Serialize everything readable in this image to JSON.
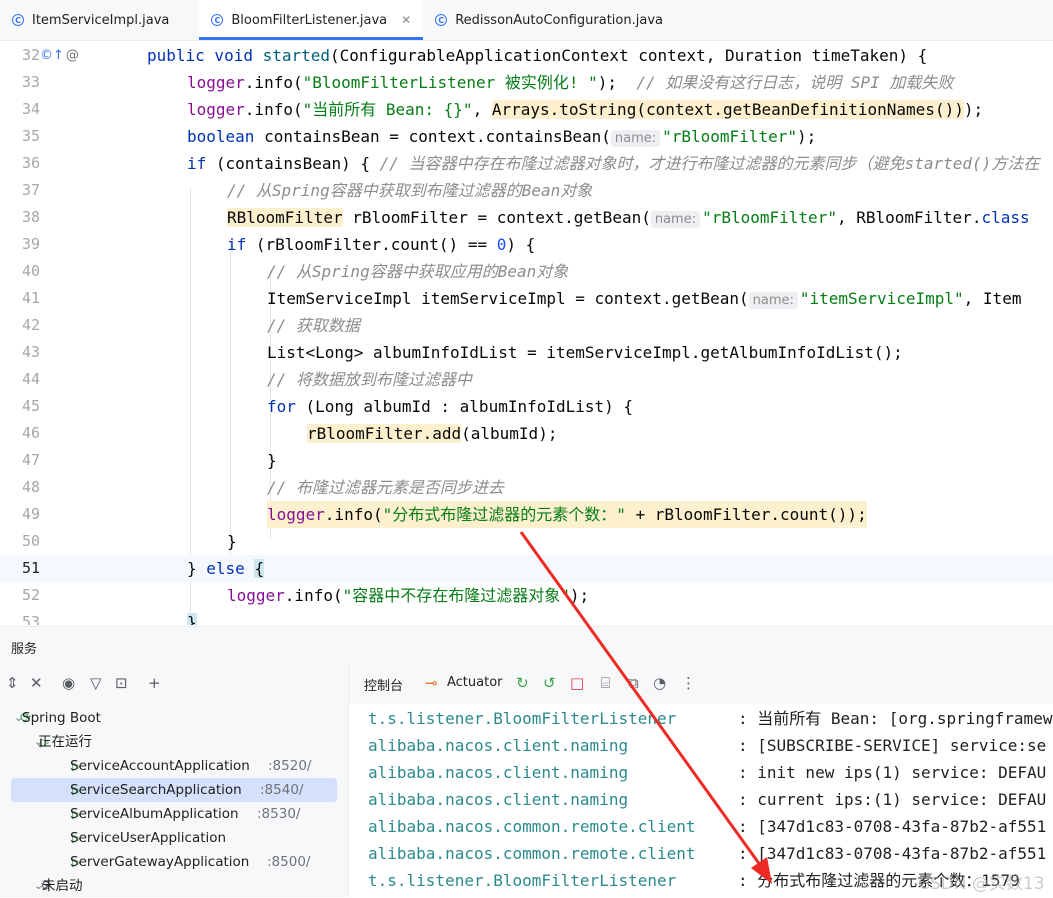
{
  "tabs": [
    {
      "label": "ItemServiceImpl.java",
      "active": false,
      "closable": false
    },
    {
      "label": "BloomFilterListener.java",
      "active": true,
      "closable": true
    },
    {
      "label": "RedissonAutoConfiguration.java",
      "active": false,
      "closable": false
    }
  ],
  "editor": {
    "line_numbers": [
      "32",
      "33",
      "34",
      "35",
      "36",
      "37",
      "38",
      "39",
      "40",
      "41",
      "42",
      "43",
      "44",
      "45",
      "46",
      "47",
      "48",
      "49",
      "50",
      "51",
      "52",
      "53"
    ],
    "current_line": "51",
    "hint_name": "name:",
    "l32": {
      "kw1": "public void ",
      "m": "started",
      "rest": "(ConfigurableApplicationContext context, Duration timeTaken) {"
    },
    "l33": {
      "f": "logger",
      "a": ".info(",
      "s": "\"BloomFilterListener 被实例化! \"",
      "b": ");  ",
      "c": "// 如果没有这行日志，说明 SPI 加载失败"
    },
    "l34": {
      "f": "logger",
      "a": ".info(",
      "s": "\"当前所有 Bean: {}\"",
      "b": ", ",
      "hl": "Arrays.toString(context.getBeanDefinitionNames())",
      "e": ");"
    },
    "l35": {
      "kw": "boolean",
      "a": " containsBean = context.containsBean(",
      "s": "\"rBloomFilter\"",
      "e": ");"
    },
    "l36": {
      "kw": "if",
      "a": " (containsBean) { ",
      "c": "// 当容器中存在布隆过滤器对象时，才进行布隆过滤器的元素同步（避免started()方法在"
    },
    "l37": {
      "c": "// 从Spring容器中获取到布隆过滤器的Bean对象"
    },
    "l38": {
      "hl": "RBloomFilter",
      "a": " rBloomFilter = context.getBean(",
      "s": "\"rBloomFilter\"",
      "e": ", RBloomFilter.",
      "kw": "class"
    },
    "l39": {
      "kw": "if",
      "a": " (rBloomFilter.count() == ",
      "n": "0",
      "e": ") {"
    },
    "l40": {
      "c": "// 从Spring容器中获取应用的Bean对象"
    },
    "l41": {
      "a": "ItemServiceImpl itemServiceImpl = context.getBean(",
      "s": "\"itemServiceImpl\"",
      "e": ", Item"
    },
    "l42": {
      "c": "// 获取数据"
    },
    "l43": {
      "a": "List<Long> albumInfoIdList = itemServiceImpl.getAlbumInfoIdList();"
    },
    "l44": {
      "c": "// 将数据放到布隆过滤器中"
    },
    "l45": {
      "kw": "for",
      "a": " (Long albumId : albumInfoIdList) {"
    },
    "l46": {
      "hl": "rBloomFilter.add",
      "e": "(albumId);"
    },
    "l47": {
      "a": "}"
    },
    "l48": {
      "c": "// 布隆过滤器元素是否同步进去"
    },
    "l49": {
      "f": "logger",
      "a": ".info(",
      "s": "\"分布式布隆过滤器的元素个数：\"",
      "e": " + rBloomFilter.count());"
    },
    "l50": {
      "a": "}"
    },
    "l51": {
      "a": "} ",
      "kw": "else",
      "sp": " ",
      "br": "{"
    },
    "l52": {
      "f": "logger",
      "a": ".info(",
      "s": "\"容器中不存在布隆过滤器对象\"",
      "e": ");"
    },
    "l53": {
      "a": "}"
    }
  },
  "services": {
    "title": "服务",
    "tree": {
      "spring_boot": "Spring Boot",
      "running": "正在运行",
      "apps": [
        {
          "name": "ServiceAccountApplication",
          "port": ":8520/"
        },
        {
          "name": "ServiceSearchApplication",
          "port": ":8540/",
          "selected": true
        },
        {
          "name": "ServiceAlbumApplication",
          "port": ":8530/"
        },
        {
          "name": "ServiceUserApplication",
          "port": ""
        },
        {
          "name": "ServerGatewayApplication",
          "port": ":8500/"
        }
      ],
      "not_started": "未启动"
    },
    "console_tab": "控制台",
    "actuator_tab": "Actuator"
  },
  "console": {
    "rows": [
      {
        "src": "t.s.listener.BloomFilterListener",
        "msg": ": 当前所有 Bean: [org.springframew"
      },
      {
        "src": "alibaba.nacos.client.naming",
        "msg": ": [SUBSCRIBE-SERVICE] service:se"
      },
      {
        "src": "alibaba.nacos.client.naming",
        "msg": ": init new ips(1) service: DEFAU"
      },
      {
        "src": "alibaba.nacos.client.naming",
        "msg": ": current ips:(1) service: DEFAU"
      },
      {
        "src": "alibaba.nacos.common.remote.client",
        "msg": ": [347d1c83-0708-43fa-87b2-af551"
      },
      {
        "src": "alibaba.nacos.common.remote.client",
        "msg": ": [347d1c83-0708-43fa-87b2-af551"
      },
      {
        "src": "t.s.listener.BloomFilterListener",
        "msg": ": 分布式布隆过滤器的元素个数：1579"
      }
    ],
    "watermark": "CSDN @实数13"
  },
  "colors": {
    "accent": "#3574f0",
    "annotation_arrow": "#ee2a24"
  }
}
